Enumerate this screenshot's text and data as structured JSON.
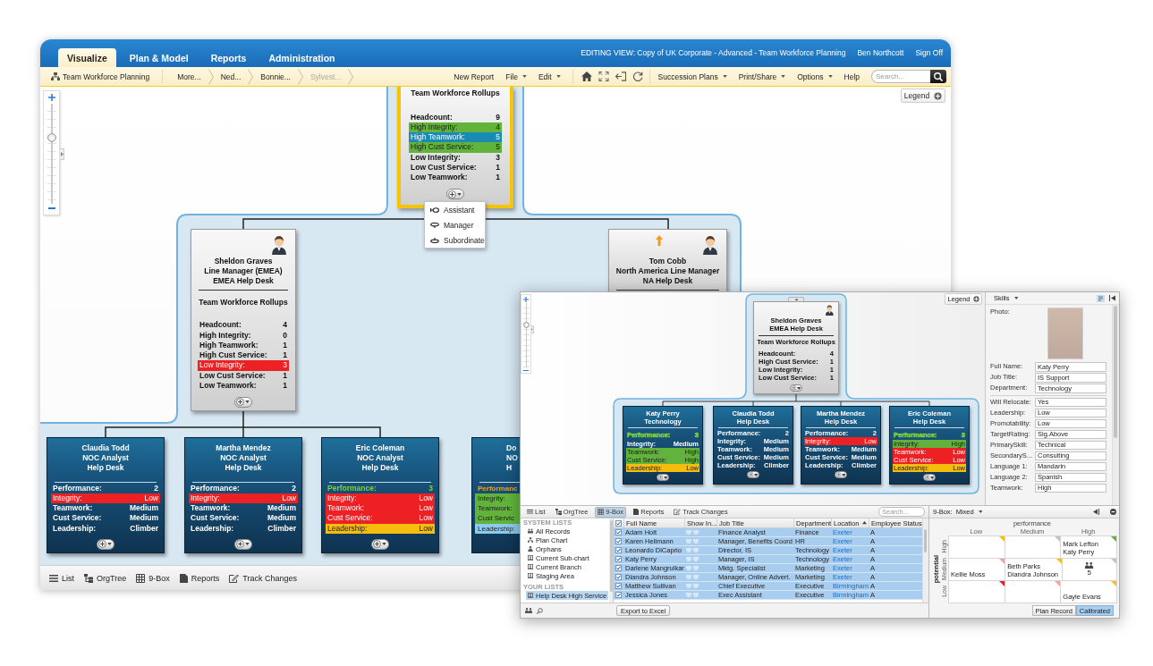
{
  "main": {
    "tabs": [
      {
        "label": "Visualize",
        "selected": true
      },
      {
        "label": "Plan & Model",
        "selected": false
      },
      {
        "label": "Reports",
        "selected": false
      },
      {
        "label": "Administration",
        "selected": false
      }
    ],
    "view_title": "EDITING VIEW: Copy of UK Corporate - Advanced - Team Workforce Planning",
    "user": "Ben Northcott",
    "sign_off": "Sign Off",
    "toolbar": {
      "chart_name": "Team Workforce Planning",
      "breadcrumbs": [
        {
          "label": "More...",
          "disabled": false
        },
        {
          "label": "Ned...",
          "disabled": false
        },
        {
          "label": "Bonnie...",
          "disabled": false
        },
        {
          "label": "Sylvest...",
          "disabled": true
        }
      ],
      "menus": [
        {
          "label": "New Report",
          "dropdown": false
        },
        {
          "label": "File",
          "dropdown": true
        },
        {
          "label": "Edit",
          "dropdown": true
        }
      ],
      "menus_right": [
        {
          "label": "Succession Plans",
          "dropdown": true
        },
        {
          "label": "Print/Share",
          "dropdown": true
        },
        {
          "label": "Options",
          "dropdown": true
        },
        {
          "label": "Help",
          "dropdown": false
        }
      ],
      "search": {
        "placeholder": "Search..."
      }
    },
    "canvas": {
      "zoom": {
        "level": 0.68
      },
      "legend": "Legend",
      "top_node": {
        "selected": true,
        "rollup_title": "Team Workforce Rollups",
        "rollups": [
          {
            "label": "Headcount:",
            "value": "9",
            "kind": "plain"
          },
          {
            "label": "High Integrity:",
            "value": "4",
            "kind": "band",
            "color": "#62b33c"
          },
          {
            "label": "High Teamwork:",
            "value": "5",
            "kind": "band",
            "color": "#1a8bb3"
          },
          {
            "label": "High Cust Service:",
            "value": "5",
            "kind": "band",
            "color": "#62b33c"
          },
          {
            "label": "Low Integrity:",
            "value": "3",
            "kind": "plain"
          },
          {
            "label": "Low Cust Service:",
            "value": "1",
            "kind": "plain"
          },
          {
            "label": "Low Teamwork:",
            "value": "1",
            "kind": "plain"
          }
        ]
      },
      "add_menu": [
        {
          "label": "Assistant"
        },
        {
          "label": "Manager"
        },
        {
          "label": "Subordinate"
        }
      ],
      "managers": [
        {
          "name": "Sheldon Graves",
          "title": "Line Manager (EMEA)",
          "department": "EMEA Help Desk",
          "selected": false,
          "up_arrow": false,
          "rollup_title": "Team Workforce Rollups",
          "rollups": [
            {
              "label": "Headcount:",
              "value": "4",
              "kind": "plain"
            },
            {
              "label": "High Integrity:",
              "value": "0",
              "kind": "plain"
            },
            {
              "label": "High Teamwork:",
              "value": "1",
              "kind": "plain"
            },
            {
              "label": "High Cust Service:",
              "value": "1",
              "kind": "plain"
            },
            {
              "label": "Low Integrity:",
              "value": "3",
              "kind": "band",
              "color": "#ed2024"
            },
            {
              "label": "Low Cust Service:",
              "value": "1",
              "kind": "plain"
            },
            {
              "label": "Low Teamwork:",
              "value": "1",
              "kind": "plain"
            }
          ]
        },
        {
          "name": "Tom Cobb",
          "title": "North America Line Manager",
          "department": "NA Help Desk",
          "selected": false,
          "up_arrow": true
        }
      ],
      "reports": [
        {
          "name": "Claudia Todd",
          "title": "NOC Analyst",
          "department": "Help Desk",
          "clipped": false,
          "metrics": [
            {
              "label": "Performance:",
              "value": "2",
              "kind": "plain"
            },
            {
              "label": "Integrity:",
              "value": "Low",
              "kind": "band",
              "color": "#ed2024"
            },
            {
              "label": "Teamwork:",
              "value": "Medium",
              "kind": "plain"
            },
            {
              "label": "Cust Service:",
              "value": "Medium",
              "kind": "plain"
            },
            {
              "label": "Leadership:",
              "value": "Climber",
              "kind": "plain"
            }
          ]
        },
        {
          "name": "Martha Mendez",
          "title": "NOC Analyst",
          "department": "Help Desk",
          "clipped": false,
          "metrics": [
            {
              "label": "Performance:",
              "value": "2",
              "kind": "plain"
            },
            {
              "label": "Integrity:",
              "value": "Low",
              "kind": "band",
              "color": "#ed2024"
            },
            {
              "label": "Teamwork:",
              "value": "Medium",
              "kind": "plain"
            },
            {
              "label": "Cust Service:",
              "value": "Medium",
              "kind": "plain"
            },
            {
              "label": "Leadership:",
              "value": "Climber",
              "kind": "plain"
            }
          ]
        },
        {
          "name": "Eric Coleman",
          "title": "NOC Analyst",
          "department": "Help Desk",
          "clipped": false,
          "metrics": [
            {
              "label": "Performance:",
              "value": "3",
              "kind": "tint",
              "color": "#7fd13b"
            },
            {
              "label": "Integrity:",
              "value": "Low",
              "kind": "band",
              "color": "#ed2024"
            },
            {
              "label": "Teamwork:",
              "value": "Low",
              "kind": "band",
              "color": "#ed2024"
            },
            {
              "label": "Cust Service:",
              "value": "Low",
              "kind": "band",
              "color": "#ed2024"
            },
            {
              "label": "Leadership:",
              "value": "Low",
              "kind": "band",
              "color": "#f6bd0f"
            }
          ]
        },
        {
          "name": "Do",
          "title": "NO",
          "department": "H",
          "clipped": true,
          "metrics": [
            {
              "label": "Performanc",
              "kind": "tint",
              "color": "#f5a01a"
            },
            {
              "label": "Integrity:",
              "kind": "band",
              "color": "#62b33c"
            },
            {
              "label": "Teamwork:",
              "kind": "band",
              "color": "#62b33c"
            },
            {
              "label": "Cust Servic",
              "kind": "band",
              "color": "#62b33c"
            },
            {
              "label": "Leadership:",
              "kind": "band",
              "color": "#8ccbee"
            }
          ]
        }
      ]
    },
    "views": [
      {
        "label": "List"
      },
      {
        "label": "OrgTree"
      },
      {
        "label": "9-Box"
      },
      {
        "label": "Reports"
      },
      {
        "label": "Track Changes"
      }
    ]
  },
  "inset": {
    "canvas": {
      "zoom": {
        "level": 0.67
      },
      "legend": "Legend",
      "manager": {
        "name": "Sheldon Graves",
        "department": "EMEA Help Desk",
        "selected": false,
        "rollup_title": "Team Workforce Rollups",
        "rollups": [
          {
            "label": "Headcount:",
            "value": "4"
          },
          {
            "label": "High Cust Service:",
            "value": "1"
          },
          {
            "label": "Low Integrity:",
            "value": "1"
          },
          {
            "label": "Low Cust Service:",
            "value": "1"
          }
        ]
      },
      "reports": [
        {
          "name": "Katy Perry",
          "department": "Technology",
          "metrics": [
            {
              "label": "Performance:",
              "value": "3",
              "kind": "tint",
              "color": "#7fd13b"
            },
            {
              "label": "Integrity:",
              "value": "Medium",
              "kind": "plain"
            },
            {
              "label": "Teamwork:",
              "value": "High",
              "kind": "band",
              "color": "#62b33c"
            },
            {
              "label": "Cust Service:",
              "value": "High",
              "kind": "band",
              "color": "#62b33c"
            },
            {
              "label": "Leadership:",
              "value": "Low",
              "kind": "band",
              "color": "#f6bd0f"
            }
          ]
        },
        {
          "name": "Claudia Todd",
          "department": "Help Desk",
          "metrics": [
            {
              "label": "Performance:",
              "value": "2"
            },
            {
              "label": "Integrity:",
              "value": "Medium"
            },
            {
              "label": "Teamwork:",
              "value": "Medium"
            },
            {
              "label": "Cust Service:",
              "value": "Medium"
            },
            {
              "label": "Leadership:",
              "value": "Climber"
            }
          ]
        },
        {
          "name": "Martha Mendez",
          "department": "Help Desk",
          "metrics": [
            {
              "label": "Performance:",
              "value": "2",
              "kind": "plain"
            },
            {
              "label": "Integrity:",
              "value": "Low",
              "kind": "band",
              "color": "#ed2024"
            },
            {
              "label": "Teamwork:",
              "value": "Medium",
              "kind": "plain"
            },
            {
              "label": "Cust Service:",
              "value": "Medium",
              "kind": "plain"
            },
            {
              "label": "Leadership:",
              "value": "Climber",
              "kind": "plain"
            }
          ]
        },
        {
          "name": "Eric Coleman",
          "department": "Help Desk",
          "metrics": [
            {
              "label": "Performance:",
              "value": "3",
              "kind": "tint",
              "color": "#7fd13b"
            },
            {
              "label": "Integrity:",
              "value": "High",
              "kind": "band",
              "color": "#62b33c"
            },
            {
              "label": "Teamwork:",
              "value": "Low",
              "kind": "band",
              "color": "#ed2024"
            },
            {
              "label": "Cust Service:",
              "value": "Low",
              "kind": "band",
              "color": "#ed2024"
            },
            {
              "label": "Leadership:",
              "value": "Low",
              "kind": "band",
              "color": "#f6bd0f"
            }
          ]
        }
      ]
    },
    "details": {
      "view": "Skills",
      "photo_label": "Photo:",
      "fields": [
        {
          "label": "Full Name:",
          "value": "Katy Perry"
        },
        {
          "label": "Job Title:",
          "value": "IS Support"
        },
        {
          "label": "Department:",
          "value": "Technology"
        }
      ],
      "skill_fields": [
        {
          "label": "Will Relocate:",
          "value": "Yes"
        },
        {
          "label": "Leadership:",
          "value": "Low"
        },
        {
          "label": "Promotability:",
          "value": "Low"
        },
        {
          "label": "TargetRating:",
          "value": "Sig.Above"
        },
        {
          "label": "PrimarySkill:",
          "value": "Technical"
        },
        {
          "label": "SecondaryS...",
          "value": "Consulting"
        },
        {
          "label": "Language 1:",
          "value": "Mandarin"
        },
        {
          "label": "Language 2:",
          "value": "Spanish"
        },
        {
          "label": "Teamwork:",
          "value": "High"
        }
      ]
    },
    "view_tabs": [
      {
        "label": "List",
        "selected": false
      },
      {
        "label": "OrgTree",
        "selected": false
      },
      {
        "label": "9-Box",
        "selected": true
      },
      {
        "label": "Reports",
        "selected": false
      },
      {
        "label": "Track Changes",
        "selected": false
      }
    ],
    "search": {
      "placeholder": "Search..."
    },
    "lists": {
      "system_heading": "SYSTEM LISTS",
      "system": [
        {
          "label": "All Records",
          "selected": false
        },
        {
          "label": "Plan Chart",
          "selected": false
        },
        {
          "label": "Orphans",
          "selected": false
        },
        {
          "label": "Current Sub-chart",
          "selected": false
        },
        {
          "label": "Current Branch",
          "selected": false
        },
        {
          "label": "Staging Area",
          "selected": false
        }
      ],
      "your_heading": "YOUR LISTS",
      "yours": [
        {
          "label": "Help Desk High Service",
          "selected": true
        }
      ]
    },
    "table": {
      "all_checked": true,
      "columns": [
        {
          "label": "Full Name",
          "sorted": false
        },
        {
          "label": "Show In...",
          "sorted": false
        },
        {
          "label": "Job Title",
          "sorted": false
        },
        {
          "label": "Department",
          "sorted": false
        },
        {
          "label": "Location",
          "sorted": true
        },
        {
          "label": "Employee Status",
          "sorted": false
        }
      ],
      "rows": [
        {
          "full_name": "Adam Holt",
          "job_title": "Finance Analyst",
          "department": "Finance",
          "location": "Exeter",
          "status": "A",
          "checked": true,
          "selected": true
        },
        {
          "full_name": "Karen Hellmann",
          "job_title": "Manager, Benefits Coord",
          "department": "HR",
          "location": "Exeter",
          "status": "A",
          "checked": true,
          "selected": true
        },
        {
          "full_name": "Leonardo DiCaprio",
          "job_title": "Director, IS",
          "department": "Technology",
          "location": "Exeter",
          "status": "A",
          "checked": true,
          "selected": true
        },
        {
          "full_name": "Katy Perry",
          "job_title": "Manager, IS",
          "department": "Technology",
          "location": "Exeter",
          "status": "A",
          "checked": true,
          "selected": true
        },
        {
          "full_name": "Darlene Mangrulkar",
          "job_title": "Mktg. Specialist",
          "department": "Marketing",
          "location": "Exeter",
          "status": "A",
          "checked": true,
          "selected": true
        },
        {
          "full_name": "Diandra Johnson",
          "job_title": "Manager, Online Advert.",
          "department": "Marketing",
          "location": "Exeter",
          "status": "A",
          "checked": true,
          "selected": true
        },
        {
          "full_name": "Matthew Sullivan",
          "job_title": "Chief Executive",
          "department": "Executive",
          "location": "Birmingham",
          "status": "A",
          "checked": true,
          "selected": true
        },
        {
          "full_name": "Jessica Jones",
          "job_title": "Exec Assistant",
          "department": "Executive",
          "location": "Birmingham",
          "status": "A",
          "checked": true,
          "selected": true
        }
      ]
    },
    "export": "Export to Excel",
    "nine_box": {
      "label": "9-Box:",
      "mode": "Mixed",
      "x_title": "performance",
      "y_title": "potential",
      "x_labels": [
        "Low",
        "Medium",
        "High"
      ],
      "y_labels": [
        "High",
        "Medium",
        "Low"
      ],
      "cells": [
        [
          {
            "color": "#f4c20d"
          },
          {
            "color": "#b7c8c8"
          },
          {
            "color": "#5cb531",
            "names": [
              "Mark Lefton",
              "Katy Perry"
            ]
          }
        ],
        [
          {
            "color": "#f3a3a3",
            "names": [
              "Kellie Moss"
            ]
          },
          {
            "color": "#f4c20d",
            "names": [
              "Beth Parks",
              "Diandra Johnson"
            ]
          },
          {
            "color": "#b7c8c8",
            "count": "5"
          }
        ],
        [
          {
            "color": "#e8202a"
          },
          {
            "color": "#f3a3a3"
          },
          {
            "color": "#f4c20d",
            "names": [
              "Gayle Evans"
            ]
          }
        ]
      ],
      "buttons": [
        {
          "label": "Plan Record",
          "selected": false
        },
        {
          "label": "Calibrated",
          "selected": true
        }
      ]
    }
  }
}
